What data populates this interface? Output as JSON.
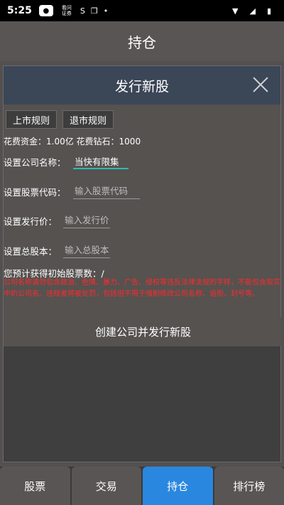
{
  "status_bar": {
    "time": "5:25",
    "icons": [
      "chat-bubble-icon",
      "notification-text-icon",
      "sync-icon",
      "file-icon",
      "dot-icon",
      "wifi-icon",
      "signal-icon",
      "battery-icon"
    ],
    "notif_text": "看问\n证券"
  },
  "header": {
    "title": "持仓"
  },
  "dialog": {
    "title": "发行新股",
    "buttons": {
      "listing_rules": "上市规则",
      "delisting_rules": "退市规则"
    },
    "cost_line": "花费资金：1.00亿 花费钻石：1000",
    "form": {
      "company_name": {
        "label": "设置公司名称：",
        "value": "当快有限集"
      },
      "stock_code": {
        "label": "设置股票代码：",
        "placeholder": "输入股票代码"
      },
      "issue_price": {
        "label": "设置发行价：",
        "placeholder": "输入发行价"
      },
      "total_shares": {
        "label": "设置总股本：",
        "placeholder": "输入总股本"
      }
    },
    "expected_shares": "您预计获得初始股票数：/",
    "warning": "公司名称请勿包含政治、色情、暴力、广告、侵权等违反法律法规的字样，不能包含现实中的公司名。违规者将被处罚，包括但不限于强制修改公司名称、追衔、封号等。",
    "create_button": "创建公司并发行新股"
  },
  "bottom_nav": {
    "tabs": [
      {
        "label": "股票",
        "active": false
      },
      {
        "label": "交易",
        "active": false
      },
      {
        "label": "持仓",
        "active": true
      },
      {
        "label": "排行榜",
        "active": false
      }
    ]
  },
  "colors": {
    "accent": "#2a87df",
    "warning": "#ff2a2a",
    "input_focus": "#2fb9b0",
    "dialog_header": "#3b4657"
  }
}
